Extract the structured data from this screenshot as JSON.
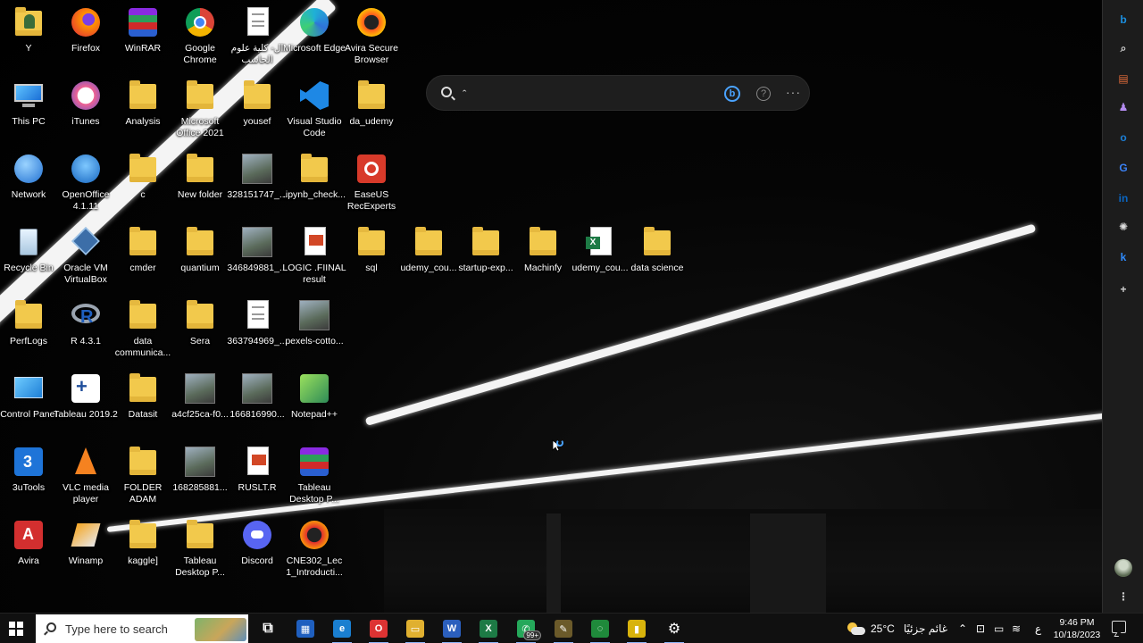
{
  "desktop": {
    "icons": [
      {
        "name": "Y",
        "kind": "user-folder-icon"
      },
      {
        "name": "Firefox",
        "kind": "firefox-icon"
      },
      {
        "name": "WinRAR",
        "kind": "winrar-icon"
      },
      {
        "name": "Google Chrome",
        "kind": "chrome-icon"
      },
      {
        "name": "ال- كلية علوم الحاسب",
        "kind": "document-icon"
      },
      {
        "name": "Microsoft Edge",
        "kind": "edge-icon"
      },
      {
        "name": "Avira Secure Browser",
        "kind": "avira-browser-icon"
      },
      {
        "name": "This PC",
        "kind": "this-pc-icon"
      },
      {
        "name": "iTunes",
        "kind": "itunes-icon"
      },
      {
        "name": "Analysis",
        "kind": "folder-icon"
      },
      {
        "name": "Microsoft Office 2021",
        "kind": "folder-icon"
      },
      {
        "name": "yousef",
        "kind": "folder-icon"
      },
      {
        "name": "Visual Studio Code",
        "kind": "vscode-icon"
      },
      {
        "name": "da_udemy",
        "kind": "folder-icon"
      },
      {
        "name": "Network",
        "kind": "network-icon"
      },
      {
        "name": "OpenOffice 4.1.11",
        "kind": "openoffice-icon"
      },
      {
        "name": "c",
        "kind": "folder-icon"
      },
      {
        "name": "New folder",
        "kind": "folder-icon"
      },
      {
        "name": "328151747_...",
        "kind": "photo-icon"
      },
      {
        "name": ".ipynb_check...",
        "kind": "folder-icon"
      },
      {
        "name": "EaseUS RecExperts",
        "kind": "easeus-icon"
      },
      {
        "name": "Recycle Bin",
        "kind": "recycle-bin-icon"
      },
      {
        "name": "Oracle VM VirtualBox",
        "kind": "virtualbox-icon"
      },
      {
        "name": "cmder",
        "kind": "folder-icon"
      },
      {
        "name": "quantium",
        "kind": "folder-icon"
      },
      {
        "name": "346849881_...",
        "kind": "photo-icon"
      },
      {
        "name": "LOGIC .FIINAL result",
        "kind": "powerpoint-file-icon"
      },
      {
        "name": "sql",
        "kind": "folder-icon"
      },
      {
        "name": "udemy_cou...",
        "kind": "folder-icon"
      },
      {
        "name": "startup-exp...",
        "kind": "folder-icon"
      },
      {
        "name": "Machinfy",
        "kind": "folder-icon"
      },
      {
        "name": "udemy_cou...",
        "kind": "excel-file-icon"
      },
      {
        "name": "data science",
        "kind": "folder-icon"
      },
      {
        "name": "PerfLogs",
        "kind": "folder-icon"
      },
      {
        "name": "R 4.3.1",
        "kind": "r-icon"
      },
      {
        "name": "data communica...",
        "kind": "folder-icon"
      },
      {
        "name": "Sera",
        "kind": "folder-icon"
      },
      {
        "name": "363794969_...",
        "kind": "document-icon"
      },
      {
        "name": "pexels-cotto...",
        "kind": "photo-icon"
      },
      {
        "name": "Control Panel",
        "kind": "control-panel-icon"
      },
      {
        "name": "Tableau 2019.2",
        "kind": "tableau-icon"
      },
      {
        "name": "Datasit",
        "kind": "folder-icon"
      },
      {
        "name": "a4cf25ca-f0...",
        "kind": "photo-icon"
      },
      {
        "name": "166816990...",
        "kind": "photo-icon"
      },
      {
        "name": "Notepad++",
        "kind": "notepadpp-icon"
      },
      {
        "name": "3uTools",
        "kind": "3utools-icon"
      },
      {
        "name": "VLC media player",
        "kind": "vlc-icon"
      },
      {
        "name": "FOLDER ADAM",
        "kind": "folder-icon"
      },
      {
        "name": "168285881...",
        "kind": "photo-icon"
      },
      {
        "name": "RUSLT.R",
        "kind": "powerpoint-file-icon"
      },
      {
        "name": "Tableau Desktop P...",
        "kind": "winrar-icon"
      },
      {
        "name": "Avira",
        "kind": "avira-icon"
      },
      {
        "name": "Winamp",
        "kind": "winamp-icon"
      },
      {
        "name": "kaggle]",
        "kind": "folder-icon"
      },
      {
        "name": "Tableau Desktop P...",
        "kind": "folder-icon"
      },
      {
        "name": "Discord",
        "kind": "discord-icon"
      },
      {
        "name": "CNE302_Lec 1_Introducti...",
        "kind": "opera-icon"
      }
    ]
  },
  "bing_search": {
    "value": "ˆ",
    "placeholder": "",
    "logo_icon": "bing-icon",
    "help_icon": "help-icon",
    "more_icon": "more-icon",
    "more_glyph": "···",
    "help_glyph": "?"
  },
  "sidebar": {
    "items": [
      {
        "icon": "bing-copilot-icon",
        "glyph": "b",
        "color": "#1b8fe0"
      },
      {
        "icon": "search-icon",
        "glyph": "⌕",
        "color": "#cfcfcf"
      },
      {
        "icon": "tools-icon",
        "glyph": "▤",
        "color": "#e06b3a"
      },
      {
        "icon": "games-icon",
        "glyph": "♟",
        "color": "#b48cf0"
      },
      {
        "icon": "outlook-icon",
        "glyph": "o",
        "color": "#1c7fd6"
      },
      {
        "icon": "translator-icon",
        "glyph": "G",
        "color": "#3b82f6"
      },
      {
        "icon": "linkedin-icon",
        "glyph": "in",
        "color": "#0a66c2"
      },
      {
        "icon": "chatgpt-icon",
        "glyph": "✺",
        "color": "#dddddd"
      },
      {
        "icon": "k-icon",
        "glyph": "k",
        "color": "#2f8cff"
      },
      {
        "icon": "add-icon",
        "glyph": "+",
        "color": "#cfcfcf"
      }
    ],
    "bottom": [
      {
        "icon": "profile-avatar-icon"
      },
      {
        "icon": "more-vertical-icon",
        "glyph": "⋮"
      }
    ]
  },
  "taskbar": {
    "search_placeholder": "Type here to search",
    "apps": [
      {
        "icon": "task-view-icon",
        "glyph": "⧉",
        "bg": "transparent"
      },
      {
        "icon": "store-icon",
        "glyph": "▦",
        "bg": "#1f5fbf"
      },
      {
        "icon": "edge-icon",
        "glyph": "e",
        "bg": "#1a7fd0"
      },
      {
        "icon": "opera-icon",
        "glyph": "O",
        "bg": "#d33"
      },
      {
        "icon": "file-explorer-icon",
        "glyph": "▭",
        "bg": "#e0b030"
      },
      {
        "icon": "word-icon",
        "glyph": "W",
        "bg": "#2b5fbd"
      },
      {
        "icon": "excel-icon",
        "glyph": "X",
        "bg": "#1d7a45"
      },
      {
        "icon": "whatsapp-icon",
        "glyph": "✆",
        "bg": "#25a85a",
        "badge": "99+"
      },
      {
        "icon": "tool-app-icon",
        "glyph": "✎",
        "bg": "#6b5a2a"
      },
      {
        "icon": "refresh-app-icon",
        "glyph": "◌",
        "bg": "#1f8a3b"
      },
      {
        "icon": "powerbi-icon",
        "glyph": "▮",
        "bg": "#d8b30c"
      },
      {
        "icon": "settings-icon",
        "glyph": "⚙",
        "bg": "transparent"
      }
    ],
    "weather": {
      "temp": "25°C",
      "desc": "غائم جزئيًا",
      "icon": "partly-cloudy-icon"
    },
    "tray": {
      "chevron_icon": "chevron-up-icon",
      "icons": [
        "network-tray-icon",
        "battery-icon",
        "wifi-icon"
      ],
      "lang": "ع"
    },
    "clock": {
      "time": "9:46 PM",
      "date": "10/18/2023"
    },
    "notification_icon": "notification-icon"
  }
}
